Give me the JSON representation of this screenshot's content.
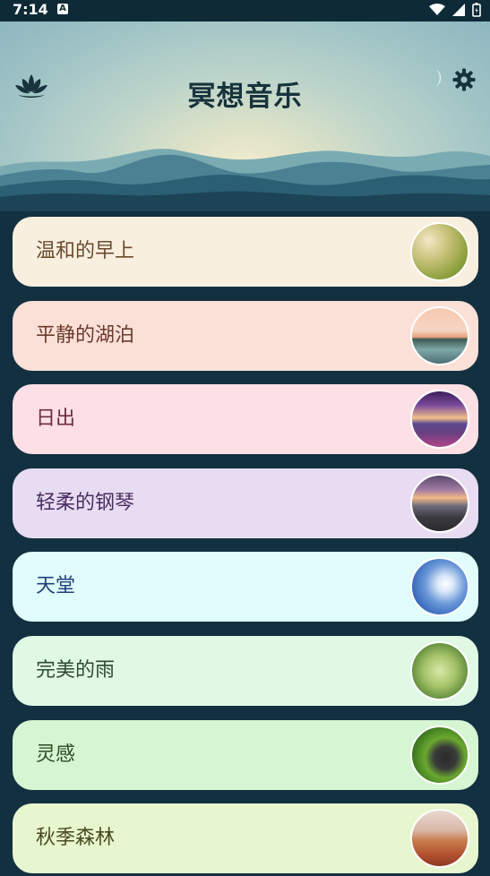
{
  "status_bar": {
    "time": "7:14",
    "notification_icon": "A"
  },
  "header": {
    "title": "冥想音乐",
    "logo_icon": "lotus-icon",
    "settings_icon": "gear-icon"
  },
  "tracks": [
    {
      "label": "温和的早上",
      "bg": "#f8efdf",
      "color": "#6b4a2f",
      "thumb": "morning-field"
    },
    {
      "label": "平静的湖泊",
      "bg": "#fbe0d8",
      "color": "#6b3b2d",
      "thumb": "calm-lake"
    },
    {
      "label": "日出",
      "bg": "#fde0e6",
      "color": "#6b2d3d",
      "thumb": "sunrise"
    },
    {
      "label": "轻柔的钢琴",
      "bg": "#e7dcf2",
      "color": "#4a2d60",
      "thumb": "soft-piano"
    },
    {
      "label": "天堂",
      "bg": "#e0fdfb",
      "color": "#23407a",
      "thumb": "heaven-sky"
    },
    {
      "label": "完美的雨",
      "bg": "#e0f9e4",
      "color": "#2d4a32",
      "thumb": "perfect-rain"
    },
    {
      "label": "灵感",
      "bg": "#d6f5d2",
      "color": "#2d4a20",
      "thumb": "inspiration-stones"
    },
    {
      "label": "秋季森林",
      "bg": "#e7f6cf",
      "color": "#4a4a20",
      "thumb": "autumn-forest"
    }
  ]
}
